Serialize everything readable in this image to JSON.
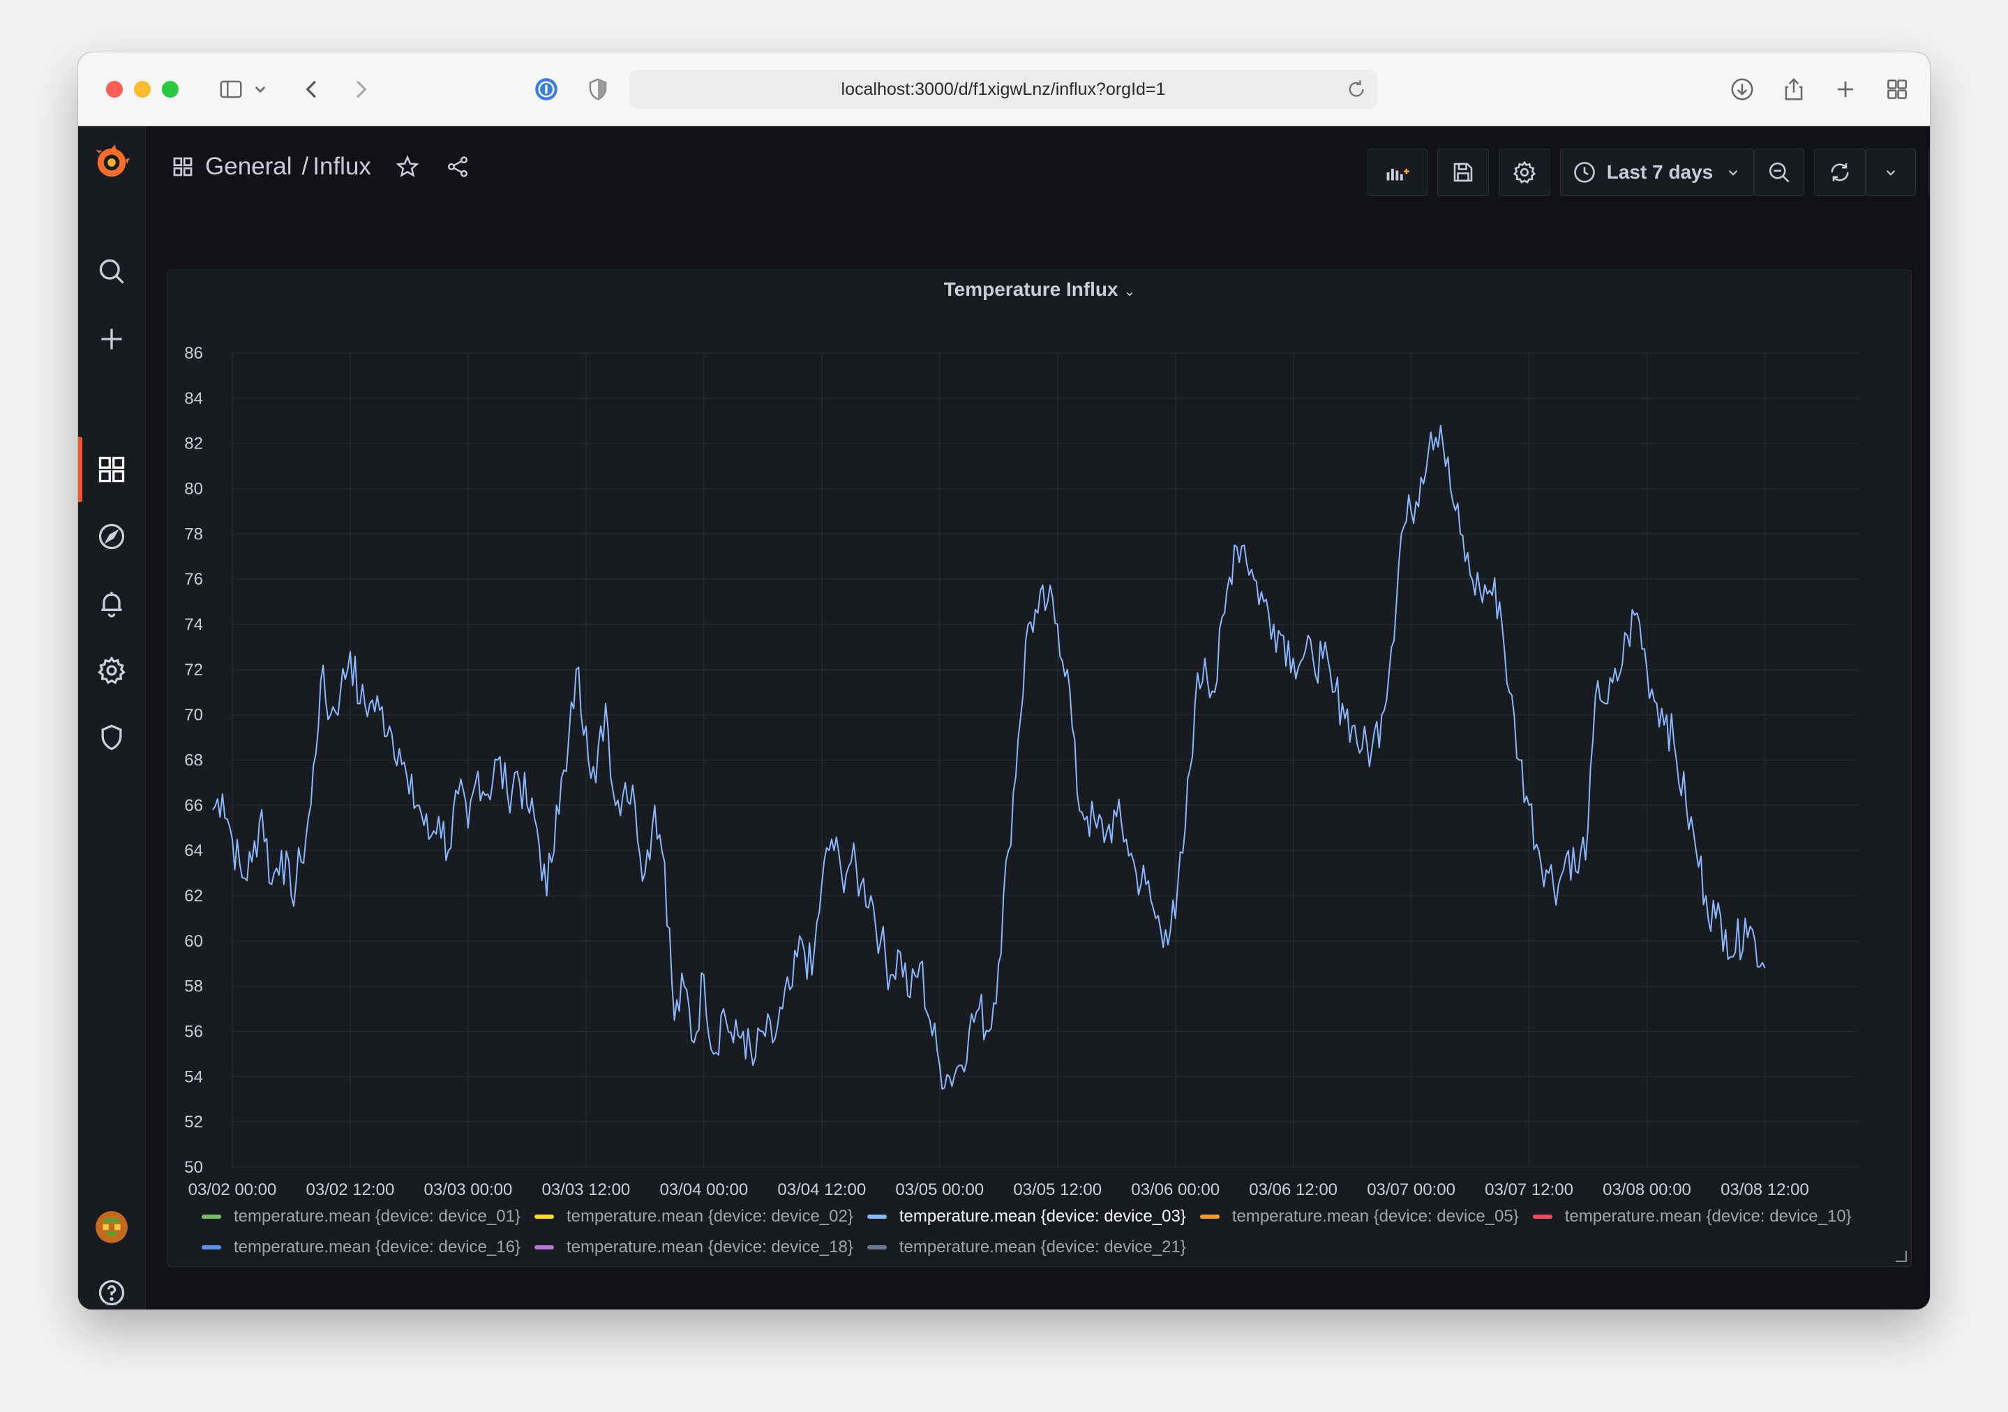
{
  "browser": {
    "url": "localhost:3000/d/f1xigwLnz/influx?orgId=1"
  },
  "breadcrumb": {
    "folder": "General",
    "separator": "/",
    "dashboard": "Influx"
  },
  "toolbar": {
    "time_range_label": "Last 7 days"
  },
  "sidebar": {
    "items": [
      "grafana-logo-icon",
      "search-icon",
      "plus-icon",
      "dashboards-icon",
      "explore-icon",
      "alerting-icon",
      "settings-icon",
      "shield-icon",
      "user-avatar",
      "help-icon"
    ],
    "active": "dashboards-icon"
  },
  "panel": {
    "title": "Temperature Influx"
  },
  "colors": {
    "background": "#111217",
    "panel": "#181b1f",
    "accent": "#f05a28",
    "series_line": "#8ab8ff"
  },
  "chart_data": {
    "type": "line",
    "title": "Temperature Influx",
    "ylim": [
      50,
      86
    ],
    "y_ticks": [
      "86",
      "84",
      "82",
      "80",
      "78",
      "76",
      "74",
      "72",
      "70",
      "68",
      "66",
      "64",
      "62",
      "60",
      "58",
      "56",
      "54",
      "52",
      "50"
    ],
    "x_ticks": [
      "03/02 00:00",
      "03/02 12:00",
      "03/03 00:00",
      "03/03 12:00",
      "03/04 00:00",
      "03/04 12:00",
      "03/05 00:00",
      "03/05 12:00",
      "03/06 00:00",
      "03/06 12:00",
      "03/07 00:00",
      "03/07 12:00",
      "03/08 00:00",
      "03/08 12:00"
    ],
    "grid": true,
    "legend_position": "bottom",
    "legend": [
      {
        "name": "temperature.mean {device: device_01}",
        "color": "#73bf69"
      },
      {
        "name": "temperature.mean {device: device_02}",
        "color": "#fade2a"
      },
      {
        "name": "temperature.mean {device: device_03}",
        "color": "#8ab8ff",
        "active": true
      },
      {
        "name": "temperature.mean {device: device_05}",
        "color": "#ff9830"
      },
      {
        "name": "temperature.mean {device: device_10}",
        "color": "#f2495c"
      },
      {
        "name": "temperature.mean {device: device_16}",
        "color": "#5794f2"
      },
      {
        "name": "temperature.mean {device: device_18}",
        "color": "#b877d9"
      },
      {
        "name": "temperature.mean {device: device_21}",
        "color": "#6b7a99"
      }
    ],
    "series": [
      {
        "name": "temperature.mean {device: device_03}",
        "color": "#8ab8ff",
        "x_hours": [
          -2,
          -1,
          0,
          1,
          2,
          3,
          4,
          5,
          6,
          7,
          8,
          9,
          10,
          11,
          12,
          13,
          14,
          15,
          16,
          17,
          18,
          19,
          20,
          21,
          22,
          23,
          24,
          25,
          26,
          27,
          28,
          29,
          30,
          31,
          32,
          33,
          34,
          35,
          36,
          37,
          38,
          39,
          40,
          41,
          42,
          43,
          44,
          45,
          46,
          47,
          48,
          49,
          50,
          51,
          52,
          53,
          54,
          55,
          56,
          57,
          58,
          59,
          60,
          61,
          62,
          63,
          64,
          65,
          66,
          67,
          68,
          69,
          70,
          71,
          72,
          73,
          74,
          75,
          76,
          77,
          78,
          79,
          80,
          81,
          82,
          83,
          84,
          85,
          86,
          87,
          88,
          89,
          90,
          91,
          92,
          93,
          94,
          95,
          96,
          97,
          98,
          99,
          100,
          101,
          102,
          103,
          104,
          105,
          106,
          107,
          108,
          109,
          110,
          111,
          112,
          113,
          114,
          115,
          116,
          117,
          118,
          119,
          120,
          121,
          122,
          123,
          124,
          125,
          126,
          127,
          128,
          129,
          130,
          131,
          132,
          133,
          134,
          135,
          136,
          137,
          138,
          139,
          140,
          141,
          142,
          143,
          144,
          145,
          146,
          147,
          148,
          149,
          150,
          151,
          152,
          153,
          154,
          155,
          156,
          157,
          158,
          159,
          160,
          161,
          162,
          163,
          164,
          165,
          166
        ],
        "values": [
          65.8,
          66.5,
          64.5,
          62.8,
          63.5,
          65.8,
          62.5,
          64,
          62,
          63.5,
          66,
          71.5,
          70,
          71,
          72.8,
          70.5,
          70.5,
          70.2,
          69.5,
          68.5,
          66.5,
          66,
          64.5,
          65.5,
          64,
          66.5,
          65,
          67.5,
          66.5,
          68,
          66.5,
          67.5,
          66,
          65,
          62,
          66,
          67.5,
          72,
          69.5,
          67,
          70.5,
          66,
          67,
          66,
          63,
          66,
          63.5,
          56.5,
          58,
          55.5,
          58.5,
          55,
          57,
          55.5,
          56,
          54.5,
          56,
          55.5,
          57,
          58,
          60,
          58.5,
          62.5,
          64.5,
          63,
          63.5,
          62.5,
          62,
          60,
          58.5,
          59.5,
          57.5,
          59,
          56.5,
          54.5,
          54,
          54.5,
          56,
          57,
          56,
          59,
          64,
          69,
          74,
          74.5,
          75,
          74,
          72,
          66.5,
          65.5,
          65,
          64.8,
          65.5,
          64.5,
          63,
          62.5,
          61,
          60.5,
          61,
          65,
          70.5,
          72.5,
          71,
          74.5,
          77.5,
          77.5,
          76,
          75,
          74,
          73.5,
          72.5,
          72.5,
          72.5,
          72.5,
          71,
          70.5,
          69.5,
          68.5,
          68.5,
          70,
          73,
          78,
          79,
          80.5,
          82.5,
          82.8,
          80,
          78,
          76.2,
          75.5,
          75.5,
          75,
          71,
          68,
          66,
          64,
          63,
          62.5,
          64,
          63,
          65,
          71.5,
          70.5,
          71.5,
          73.5,
          74.5,
          72,
          70.5,
          70,
          68,
          66,
          64,
          62,
          61,
          60.5,
          59.5,
          61,
          60,
          58.8
        ]
      }
    ]
  }
}
